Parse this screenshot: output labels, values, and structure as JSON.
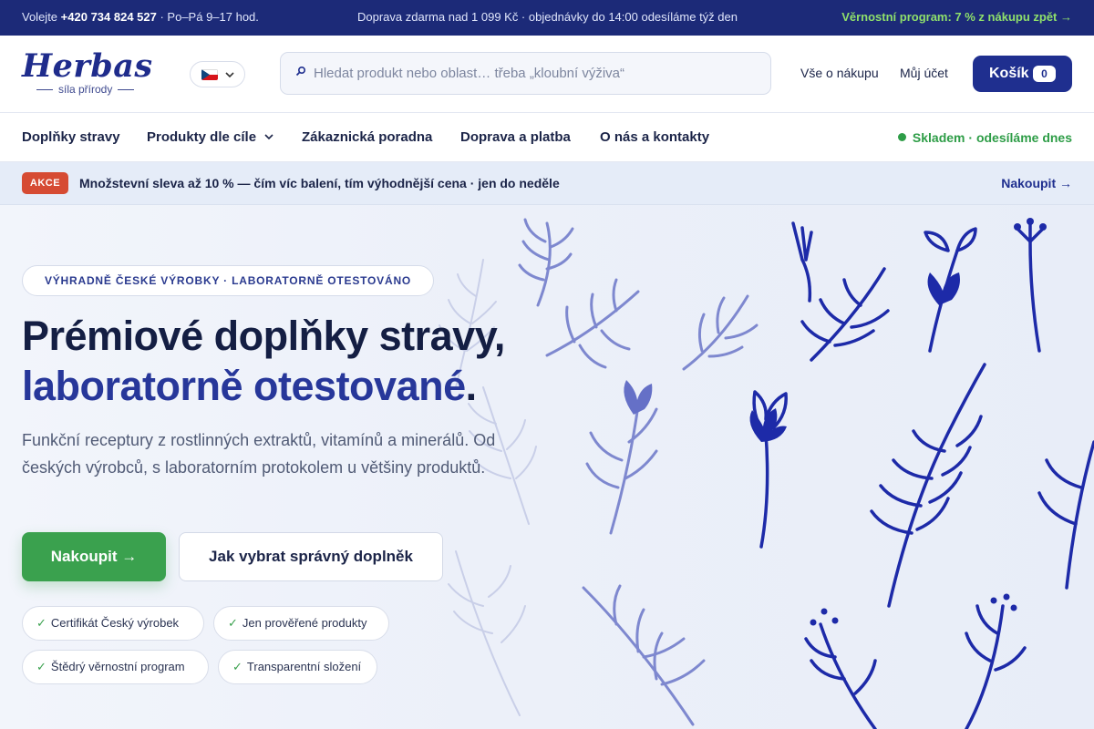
{
  "topbar": {
    "call_prefix": "Volejte",
    "phone": "+420 734 824 527",
    "hours": "· Po–Pá 9–17 hod.",
    "shipping": "Doprava zdarma nad 1 099 Kč · objednávky do 14:00 odesíláme týž den",
    "loyalty": "Věrnostní program: 7 % z nákupu zpět →"
  },
  "header": {
    "logo_word": "Herbas",
    "logo_tagline": "síla přírody",
    "language_icon": "czech-flag-icon",
    "search_placeholder": "Hledat produkt nebo oblast… třeba „kloubní výživa“",
    "links": [
      "Vše o nákupu",
      "Můj účet"
    ],
    "cart_label": "Košík",
    "cart_count": "0"
  },
  "nav": {
    "items": [
      "Doplňky stravy",
      "Produkty dle cíle",
      "Zákaznická poradna",
      "Doprava a platba",
      "O nás a kontakty"
    ],
    "stock_status": "Skladem · odesíláme dnes"
  },
  "promo": {
    "badge": "AKCE",
    "text": "Množstevní sleva až 10 % — čím víc balení, tím výhodnější cena · jen do neděle",
    "link": "Nakoupit →"
  },
  "hero": {
    "pill": "VÝHRADNĚ ČESKÉ VÝROBKY · LABORATORNĚ OTESTOVÁNO",
    "title_line1": "Prémiové doplňky stravy,",
    "title_line2": "laboratorně otestované",
    "title_period": ".",
    "lead": "Funkční receptury z rostlinných extraktů, vitamínů a minerálů. Od českých výrobců, s laboratorním protokolem u většiny produktů.",
    "primary_button": "Nakoupit →",
    "secondary_button": "Jak vybrat správný doplněk",
    "badges": [
      "Certifikát Český výrobek",
      "Jen prověřené produkty",
      "Štědrý věrnostní program",
      "Transparentní složení"
    ]
  },
  "colors": {
    "brand": "#1f2f8f",
    "accent_green": "#3aa14e",
    "sale_red": "#d64b33",
    "topbar": "#1c2a78"
  }
}
